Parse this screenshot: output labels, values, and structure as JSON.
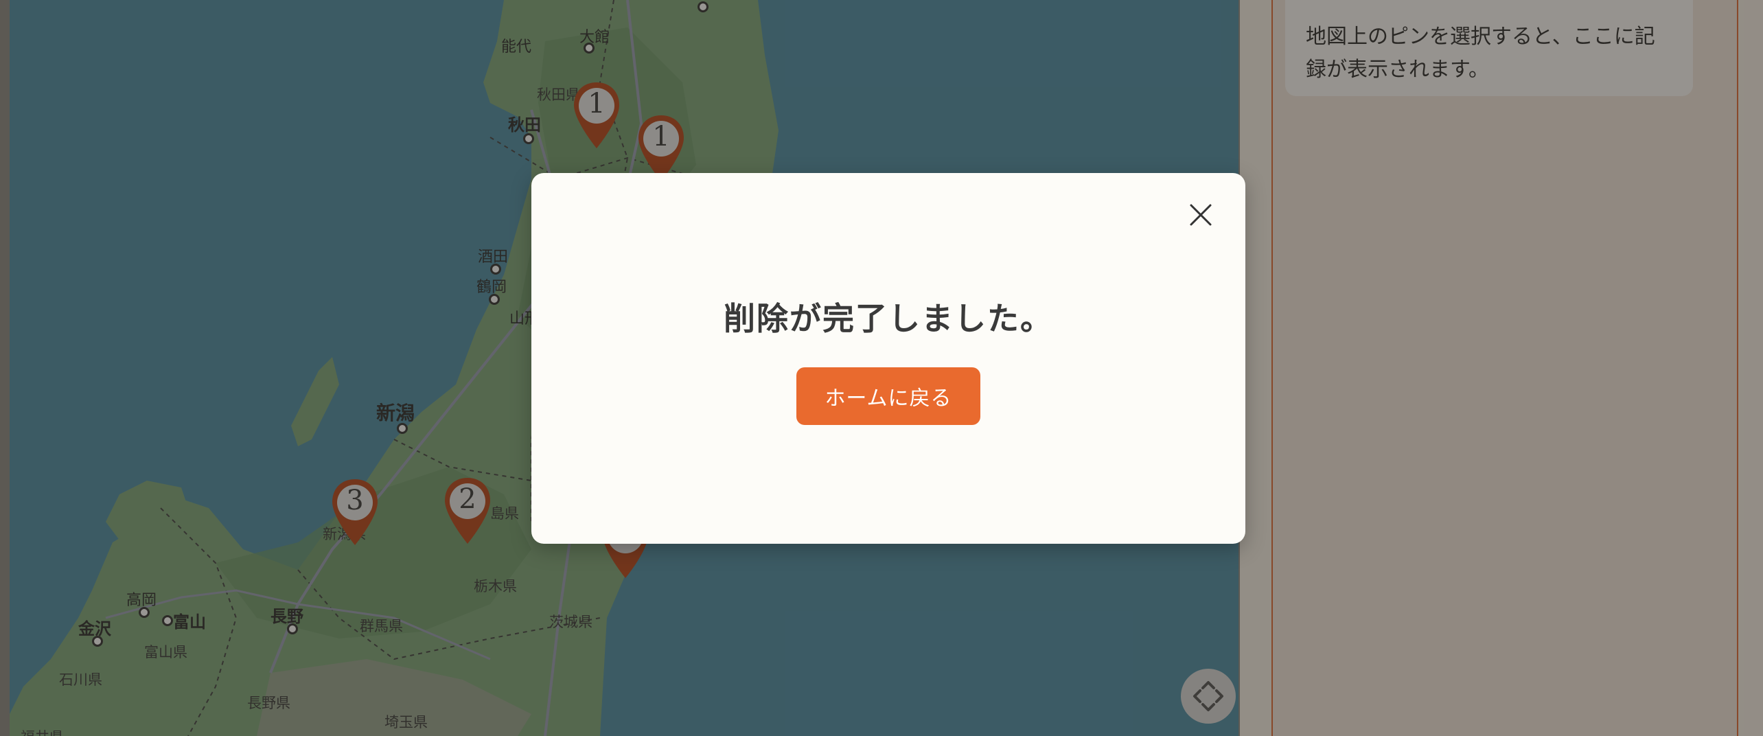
{
  "map": {
    "labels": {
      "noshiro": "能代",
      "odate": "大館",
      "akita_pref": "秋田県",
      "akita": "秋田",
      "sakata": "酒田",
      "tsuruoka": "鶴岡",
      "yama": "山形",
      "niigata": "新潟",
      "niigata_pref": "新潟県",
      "fukushima_pref": "島県",
      "tochigi_pref": "栃木県",
      "ibaraki_pref": "茨城県",
      "gunma_pref": "群馬県",
      "nagano": "長野",
      "nagano_pref": "長野県",
      "saitama_pref": "埼玉県",
      "toyama": "富山",
      "toyama_pref": "富山県",
      "takaoka": "高岡",
      "kanazawa": "金沢",
      "ishikawa_pref": "石川県",
      "fukui_pref": "福井県"
    },
    "pins": [
      {
        "count": "1"
      },
      {
        "count": "1"
      },
      {
        "count": "3"
      },
      {
        "count": "2"
      }
    ],
    "locate_icon": "move-arrows-icon"
  },
  "sidebar": {
    "hint": "地図上のピンを選択すると、ここに記録が表示されます。"
  },
  "modal": {
    "title": "削除が完了しました。",
    "home_button": "ホームに戻る",
    "close_icon": "close-icon"
  },
  "colors": {
    "accent": "#e96a2e",
    "pin": "#b8481b",
    "sea": "#4f8fa6",
    "land": "#7fa87c"
  }
}
